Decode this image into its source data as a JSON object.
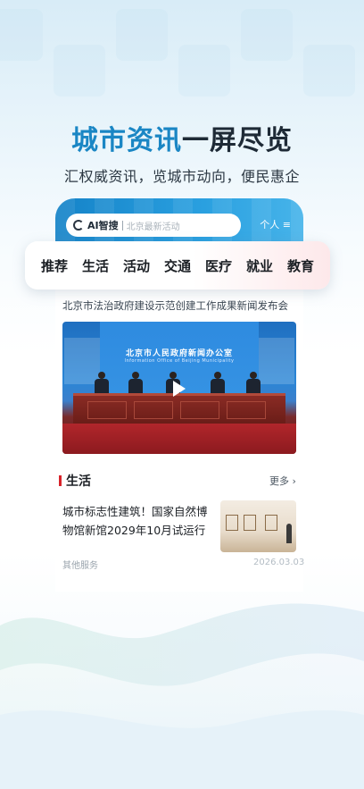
{
  "promo": {
    "headline_blue": "城市资讯",
    "headline_dark": "一屏尽览",
    "subline": "汇权威资讯，览城市动向，便民惠企"
  },
  "app_header": {
    "ai_label": "AI智搜",
    "search_placeholder": "北京最新活动",
    "personal_label": "个人 ≡",
    "accent_color": "#1a86c4"
  },
  "categories": [
    "推荐",
    "生活",
    "活动",
    "交通",
    "医疗",
    "就业",
    "教育"
  ],
  "featured": {
    "title": "北京市法治政府建设示范创建工作成果新闻发布会",
    "video_banner_cn": "北京市人民政府新闻办公室",
    "video_banner_en": "Information Office of Beijing Municipality"
  },
  "section": {
    "title": "生活",
    "more_label": "更多 ›",
    "accent_color": "#d8232a"
  },
  "article": {
    "title": "城市标志性建筑！国家自然博物馆新馆2029年10月试运行",
    "source": "其他服务",
    "date": "2026.03.03"
  }
}
